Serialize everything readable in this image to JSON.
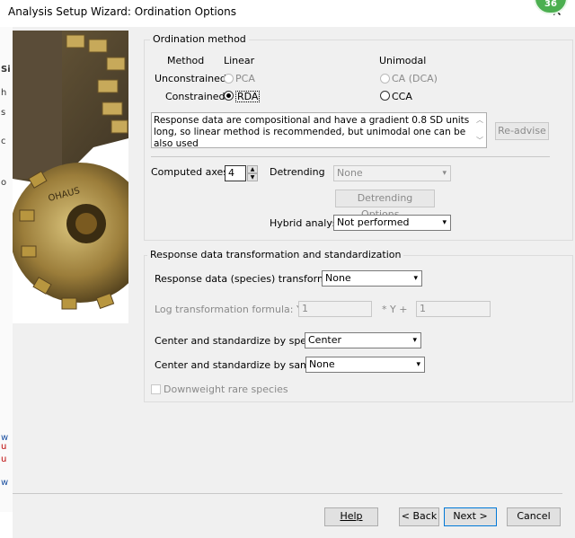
{
  "window": {
    "title": "Analysis Setup Wizard: Ordination Options",
    "badge": "36",
    "close_symbol": "✕"
  },
  "ordination": {
    "legend": "Ordination method",
    "col_method": "Method",
    "col_linear": "Linear",
    "col_unimodal": "Unimodal",
    "row_unconstrained": "Unconstrained",
    "row_constrained": "Constrained",
    "pca": "PCA",
    "rda": "RDA",
    "ca": "CA (DCA)",
    "cca": "CCA",
    "selected": "RDA"
  },
  "advice": {
    "text": "Response data are compositional and have a gradient 0.8 SD units long, so linear method is recommended, but unimodal one can be also used",
    "readvise_label": "Re-advise"
  },
  "axes": {
    "label": "Computed axes:",
    "value": "4",
    "detrending_label": "Detrending",
    "detrending_value": "None",
    "detrending_options_label": "Detrending Options...",
    "hybrid_label": "Hybrid analysis",
    "hybrid_value": "Not performed"
  },
  "transform": {
    "legend": "Response data transformation and standardization",
    "species_transform_label": "Response data (species) transformation",
    "species_transform_value": "None",
    "log_formula_label": "Log transformation formula: Y' =",
    "log_a": "1",
    "log_mid": "* Y +",
    "log_b": "1",
    "center_species_label": "Center and standardize by species",
    "center_species_value": "Center",
    "center_samples_label": "Center and standardize by samples",
    "center_samples_value": "None",
    "downweight_label": "Downweight rare species"
  },
  "footer": {
    "help_label": "Help",
    "back_label": "< Back",
    "next_label": "Next >",
    "cancel_label": "Cancel"
  },
  "background": {
    "line_s": "Si",
    "line_h": "h",
    "line_s2": "s",
    "line_c": "c",
    "line_o": "o",
    "line_w1": "w",
    "line_u1": "u",
    "line_u2": "u",
    "line_w2": "w"
  },
  "colors": {
    "badge_green": "#4caf50",
    "dialog_bg": "#f0f0f0"
  }
}
